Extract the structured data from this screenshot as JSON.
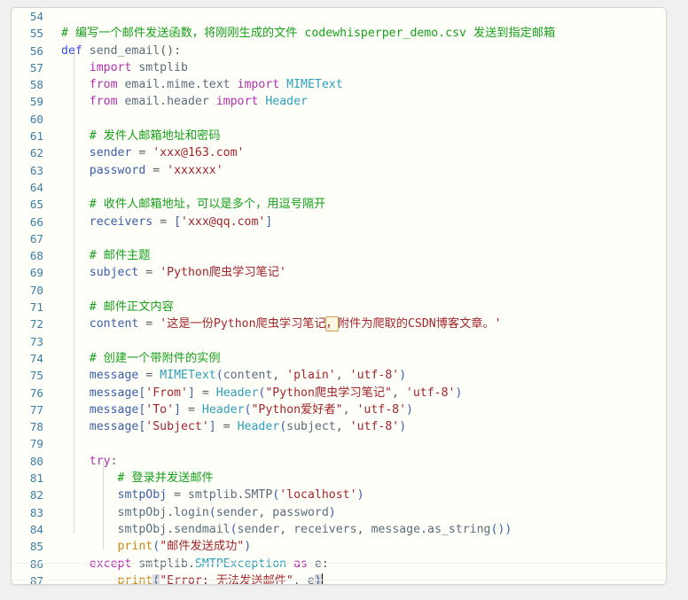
{
  "editor": {
    "language": "python",
    "gutter_color": "#3b7ca3",
    "panel_background": "#fffffa",
    "panel_border": "#d4d4d4",
    "page_background": "#f0f0f0",
    "caret_line": 87,
    "theme_colors": {
      "comment": "#17a01a",
      "keyword": "#b32fb0",
      "def_keyword": "#3b4fd8",
      "identifier": "#5b6d7b",
      "type": "#2e9fbb",
      "string": "#a3242a",
      "builtin": "#d18616",
      "variable": "#3b5ea8",
      "match_highlight": "#c8a24a",
      "paren_match_bg": "#d9d9d9"
    },
    "lines": [
      {
        "num": "54",
        "text": ""
      },
      {
        "num": "55",
        "text": "# 编写一个邮件发送函数，将刚刚生成的文件 codewhisperper_demo.csv 发送到指定邮箱"
      },
      {
        "num": "56",
        "text": "def send_email():"
      },
      {
        "num": "57",
        "text": "    import smtplib"
      },
      {
        "num": "58",
        "text": "    from email.mime.text import MIMEText"
      },
      {
        "num": "59",
        "text": "    from email.header import Header"
      },
      {
        "num": "60",
        "text": ""
      },
      {
        "num": "61",
        "text": "    # 发件人邮箱地址和密码"
      },
      {
        "num": "62",
        "text": "    sender = 'xxx@163.com'"
      },
      {
        "num": "63",
        "text": "    password = 'xxxxxx'"
      },
      {
        "num": "64",
        "text": ""
      },
      {
        "num": "65",
        "text": "    # 收件人邮箱地址，可以是多个，用逗号隔开"
      },
      {
        "num": "66",
        "text": "    receivers = ['xxx@qq.com']"
      },
      {
        "num": "67",
        "text": ""
      },
      {
        "num": "68",
        "text": "    # 邮件主题"
      },
      {
        "num": "69",
        "text": "    subject = 'Python爬虫学习笔记'"
      },
      {
        "num": "70",
        "text": ""
      },
      {
        "num": "71",
        "text": "    # 邮件正文内容"
      },
      {
        "num": "72",
        "text": "    content = '这是一份Python爬虫学习笔记，附件为爬取的CSDN博客文章。'"
      },
      {
        "num": "73",
        "text": ""
      },
      {
        "num": "74",
        "text": "    # 创建一个带附件的实例"
      },
      {
        "num": "75",
        "text": "    message = MIMEText(content, 'plain', 'utf-8')"
      },
      {
        "num": "76",
        "text": "    message['From'] = Header(\"Python爬虫学习笔记\", 'utf-8')"
      },
      {
        "num": "77",
        "text": "    message['To'] = Header(\"Python爱好者\", 'utf-8')"
      },
      {
        "num": "78",
        "text": "    message['Subject'] = Header(subject, 'utf-8')"
      },
      {
        "num": "79",
        "text": ""
      },
      {
        "num": "80",
        "text": "    try:"
      },
      {
        "num": "81",
        "text": "        # 登录并发送邮件"
      },
      {
        "num": "82",
        "text": "        smtpObj = smtplib.SMTP('localhost')"
      },
      {
        "num": "83",
        "text": "        smtpObj.login(sender, password)"
      },
      {
        "num": "84",
        "text": "        smtpObj.sendmail(sender, receivers, message.as_string())"
      },
      {
        "num": "85",
        "text": "        print(\"邮件发送成功\")"
      },
      {
        "num": "86",
        "text": "    except smtplib.SMTPException as e:"
      },
      {
        "num": "87",
        "text": "        print(\"Error: 无法发送邮件\", e)"
      }
    ],
    "tokens": {
      "l55_comment": "# 编写一个邮件发送函数，将刚刚生成的文件 codewhisperper_demo.csv 发送到指定邮箱",
      "l56_def": "def",
      "l56_name": "send_email",
      "l56_tail": "():",
      "l57_kw": "import",
      "l57_mod": "smtplib",
      "l58_from": "from",
      "l58_mod": "email.mime.text",
      "l58_import": "import",
      "l58_type": "MIMEText",
      "l59_from": "from",
      "l59_mod": "email.header",
      "l59_import": "import",
      "l59_type": "Header",
      "l61_comment": "# 发件人邮箱地址和密码",
      "l62_var": "sender",
      "l62_str": "'xxx@163.com'",
      "l63_var": "password",
      "l63_str": "'xxxxxx'",
      "l65_comment": "# 收件人邮箱地址，可以是多个，用逗号隔开",
      "l66_var": "receivers",
      "l66_str": "'xxx@qq.com'",
      "l68_comment": "# 邮件主题",
      "l69_var": "subject",
      "l69_str": "'Python爬虫学习笔记'",
      "l71_comment": "# 邮件正文内容",
      "l72_var": "content",
      "l72_str_a": "'这是一份Python爬虫学习笔记",
      "l72_str_comma": "，",
      "l72_str_b": "附件为爬取的CSDN博客文章。'",
      "l74_comment": "# 创建一个带附件的实例",
      "l75_var": "message",
      "l75_type": "MIMEText",
      "l75_arg": "content",
      "l75_s1": "'plain'",
      "l75_s2": "'utf-8'",
      "l76_var": "message",
      "l76_key": "'From'",
      "l76_type": "Header",
      "l76_s1": "\"Python爬虫学习笔记\"",
      "l76_s2": "'utf-8'",
      "l77_var": "message",
      "l77_key": "'To'",
      "l77_type": "Header",
      "l77_s1": "\"Python爱好者\"",
      "l77_s2": "'utf-8'",
      "l78_var": "message",
      "l78_key": "'Subject'",
      "l78_type": "Header",
      "l78_arg": "subject",
      "l78_s2": "'utf-8'",
      "l80_try": "try",
      "l81_comment": "# 登录并发送邮件",
      "l82_var": "smtpObj",
      "l82_mod": "smtplib",
      "l82_fn": "SMTP",
      "l82_str": "'localhost'",
      "l83_obj": "smtpObj",
      "l83_fn": "login",
      "l83_a1": "sender",
      "l83_a2": "password",
      "l84_obj": "smtpObj",
      "l84_fn": "sendmail",
      "l84_a1": "sender",
      "l84_a2": "receivers",
      "l84_a3": "message",
      "l84_a3m": "as_string",
      "l85_print": "print",
      "l85_str": "\"邮件发送成功\"",
      "l86_except": "except",
      "l86_mod": "smtplib",
      "l86_exc": "SMTPException",
      "l86_as": "as",
      "l86_e": "e",
      "l87_print": "print",
      "l87_str": "\"Error: 无法发送邮件\"",
      "l87_e": "e"
    }
  }
}
